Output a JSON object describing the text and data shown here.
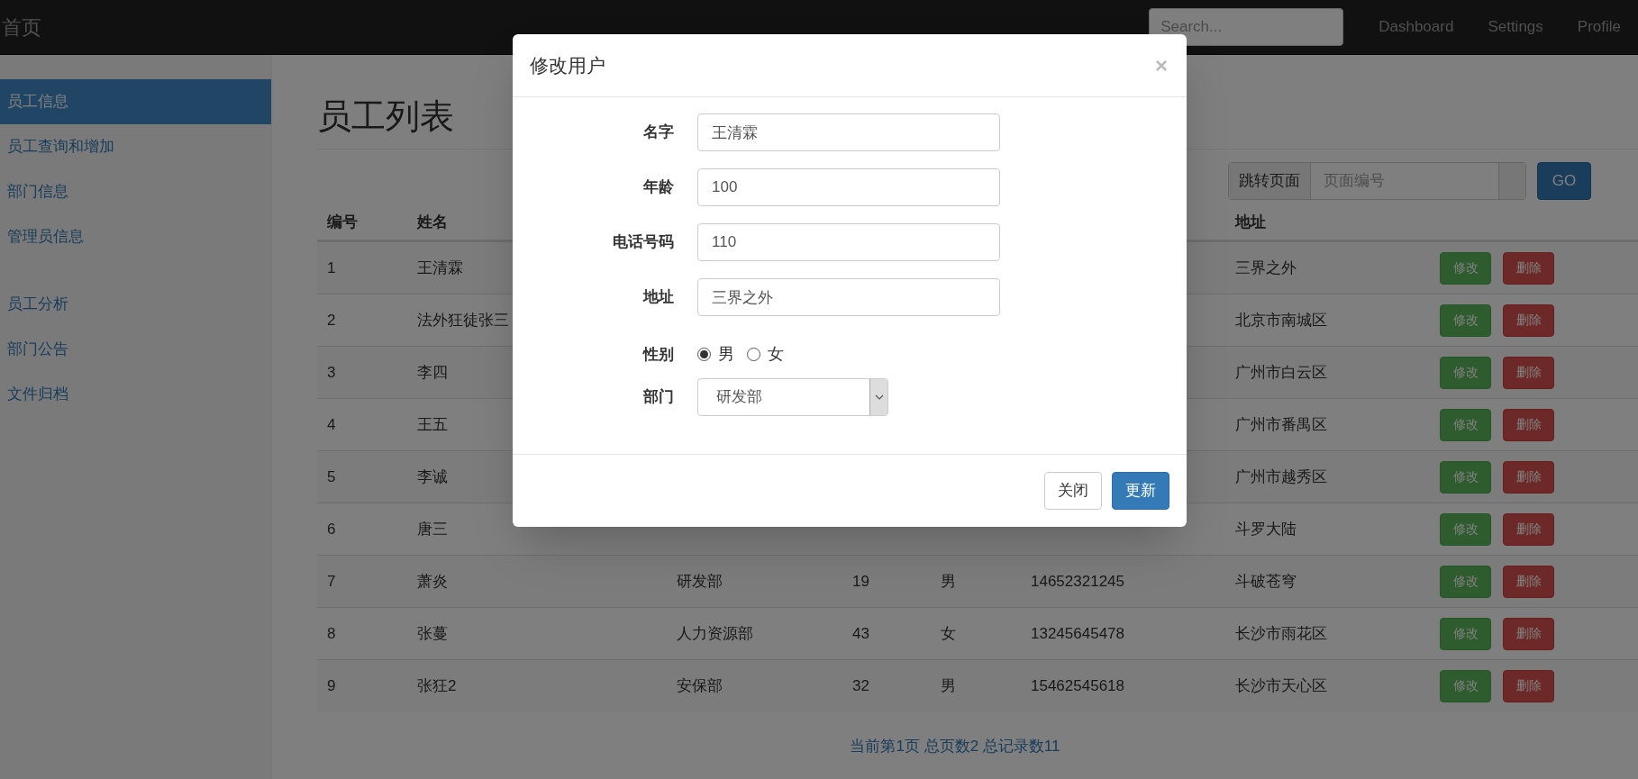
{
  "navbar": {
    "brand": "首页",
    "search": {
      "placeholder": "Search..."
    },
    "links": [
      "Dashboard",
      "Settings",
      "Profile"
    ]
  },
  "sidebar": {
    "groups": [
      [
        {
          "label": "员工信息",
          "selected": true
        },
        {
          "label": "员工查询和增加",
          "selected": false
        },
        {
          "label": "部门信息",
          "selected": false
        },
        {
          "label": "管理员信息",
          "selected": false
        }
      ],
      [
        {
          "label": "员工分析",
          "selected": false
        },
        {
          "label": "部门公告",
          "selected": false
        },
        {
          "label": "文件归档",
          "selected": false
        }
      ]
    ]
  },
  "page_title": "员工列表",
  "jump": {
    "label": "跳转页面",
    "placeholder": "页面编号",
    "button": "GO"
  },
  "table": {
    "headers": {
      "id": "编号",
      "name": "姓名",
      "address": "地址"
    },
    "rows": [
      {
        "id": "1",
        "name": "王清霖",
        "address": "三界之外",
        "edit": "修改",
        "delete": "删除"
      },
      {
        "id": "2",
        "name": "法外狂徒张三",
        "address": "北京市南城区",
        "edit": "修改",
        "delete": "删除"
      },
      {
        "id": "3",
        "name": "李四",
        "address": "广州市白云区",
        "edit": "修改",
        "delete": "删除"
      },
      {
        "id": "4",
        "name": "王五",
        "address": "广州市番禺区",
        "edit": "修改",
        "delete": "删除"
      },
      {
        "id": "5",
        "name": "李诚",
        "address": "广州市越秀区",
        "edit": "修改",
        "delete": "删除"
      },
      {
        "id": "6",
        "name": "唐三",
        "address": "斗罗大陆",
        "edit": "修改",
        "delete": "删除"
      },
      {
        "id": "7",
        "name": "萧炎",
        "department": "研发部",
        "age": "19",
        "gender": "男",
        "phone": "14652321245",
        "address": "斗破苍穹",
        "edit": "修改",
        "delete": "删除"
      },
      {
        "id": "8",
        "name": "张蔓",
        "department": "人力资源部",
        "age": "43",
        "gender": "女",
        "phone": "13245645478",
        "address": "长沙市雨花区",
        "edit": "修改",
        "delete": "删除"
      },
      {
        "id": "9",
        "name": "张狂2",
        "department": "安保部",
        "age": "32",
        "gender": "男",
        "phone": "15462545618",
        "address": "长沙市天心区",
        "edit": "修改",
        "delete": "删除"
      }
    ]
  },
  "pagination_info": "当前第1页 总页数2 总记录数11",
  "modal": {
    "title": "修改用户",
    "close": "×",
    "fields": [
      {
        "kind": "text",
        "label": "名字",
        "value": "王清霖"
      },
      {
        "kind": "text",
        "label": "年龄",
        "value": "100"
      },
      {
        "kind": "text",
        "label": "电话号码",
        "value": "110"
      },
      {
        "kind": "text",
        "label": "地址",
        "value": "三界之外"
      },
      {
        "kind": "radio",
        "label": "性别",
        "options": [
          {
            "label": "男",
            "selected": true
          },
          {
            "label": "女",
            "selected": false
          }
        ]
      },
      {
        "kind": "select",
        "label": "部门",
        "value": "研发部"
      }
    ],
    "buttons": [
      {
        "label": "关闭",
        "kind": "default"
      },
      {
        "label": "更新",
        "kind": "primary"
      }
    ]
  }
}
